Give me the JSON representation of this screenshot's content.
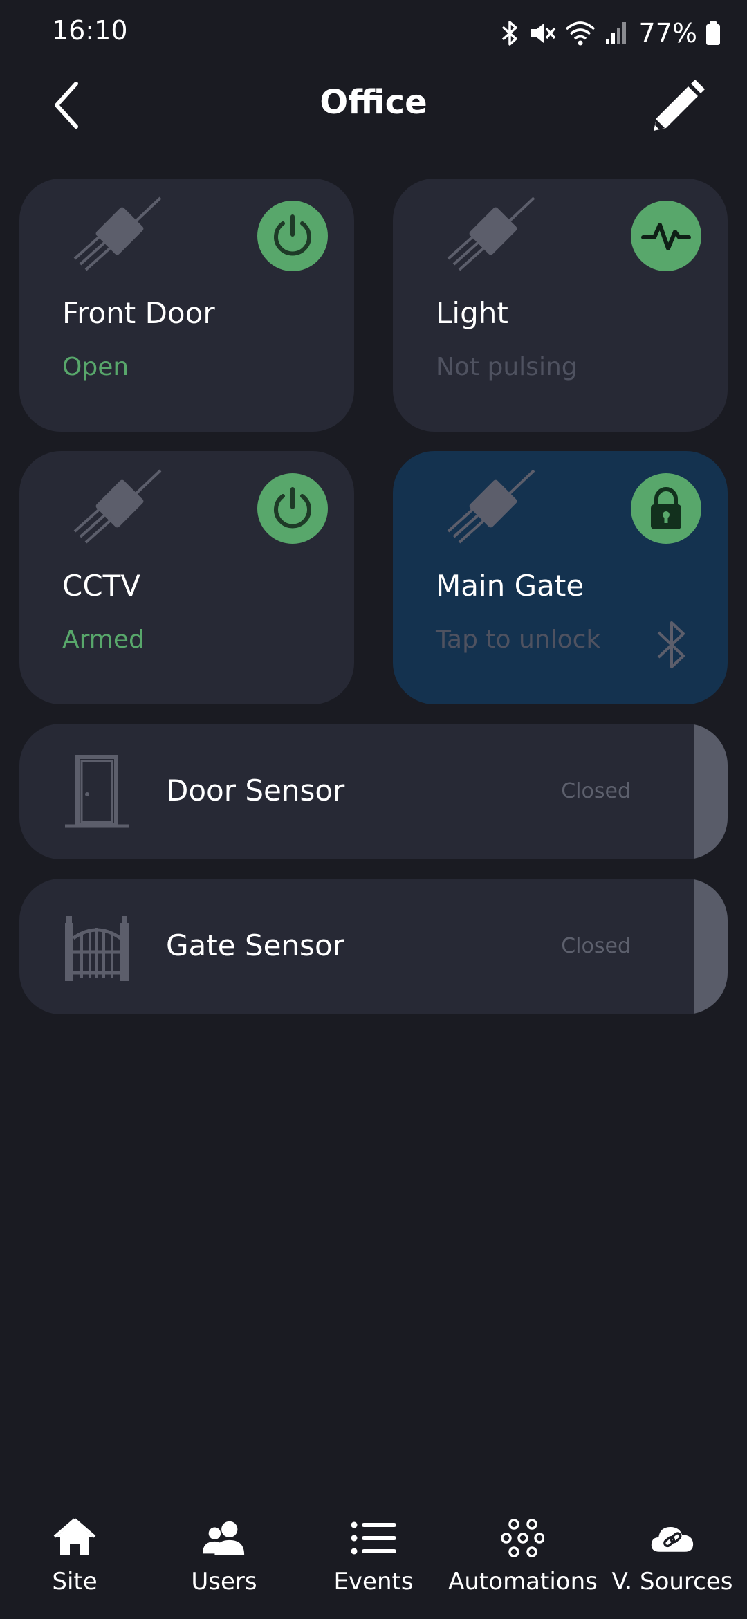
{
  "status_bar": {
    "time": "16:10",
    "battery": "77%"
  },
  "header": {
    "title": "Office"
  },
  "tiles": [
    {
      "name": "Front Door",
      "status": "Open",
      "action_icon": "power-icon"
    },
    {
      "name": "Light",
      "status": "Not pulsing",
      "action_icon": "pulse-icon"
    },
    {
      "name": "CCTV",
      "status": "Armed",
      "action_icon": "power-icon"
    },
    {
      "name": "Main Gate",
      "status": "Tap to unlock",
      "action_icon": "lock-icon"
    }
  ],
  "sensors": [
    {
      "name": "Door Sensor",
      "state": "Closed",
      "icon": "door-icon"
    },
    {
      "name": "Gate Sensor",
      "state": "Closed",
      "icon": "gate-icon"
    }
  ],
  "nav": [
    {
      "label": "Site",
      "icon": "home-icon"
    },
    {
      "label": "Users",
      "icon": "users-icon"
    },
    {
      "label": "Events",
      "icon": "list-icon"
    },
    {
      "label": "Automations",
      "icon": "automations-icon"
    },
    {
      "label": "V. Sources",
      "icon": "cloud-link-icon"
    }
  ],
  "colors": {
    "background": "#1a1b22",
    "tile": "#272935",
    "tile_active": "#14324f",
    "accent_green": "#58a76b",
    "muted_text": "#4f5260"
  }
}
